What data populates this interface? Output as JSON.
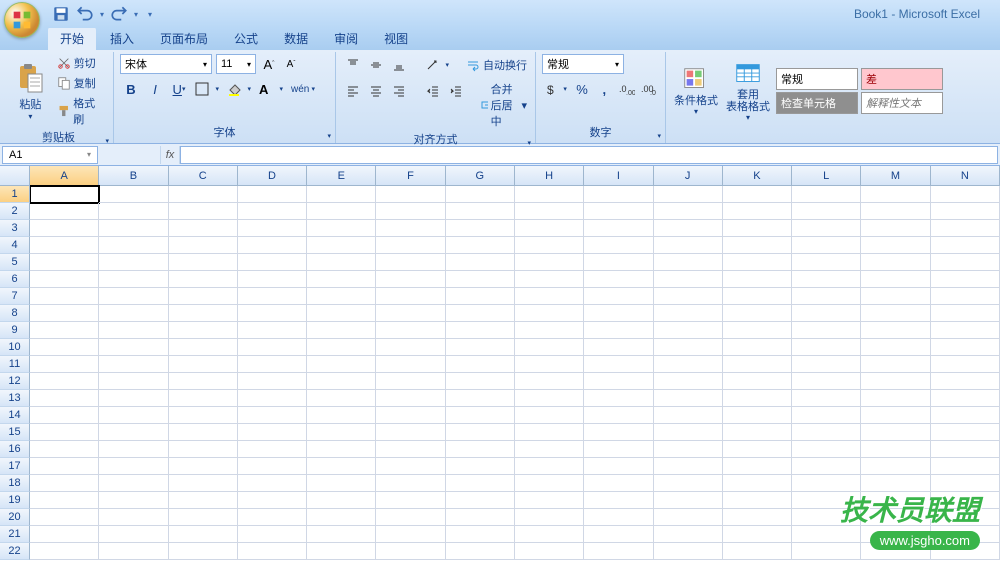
{
  "title": "Book1 - Microsoft Excel",
  "tabs": [
    "开始",
    "插入",
    "页面布局",
    "公式",
    "数据",
    "审阅",
    "视图"
  ],
  "active_tab": 0,
  "clipboard": {
    "paste": "粘贴",
    "cut": "剪切",
    "copy": "复制",
    "format_painter": "格式刷",
    "group": "剪贴板"
  },
  "font": {
    "name": "宋体",
    "size": "11",
    "group": "字体"
  },
  "alignment": {
    "wrap": "自动换行",
    "merge": "合并后居中",
    "group": "对齐方式"
  },
  "number": {
    "format": "常规",
    "group": "数字"
  },
  "styles": {
    "conditional": "条件格式",
    "table": "套用\n表格格式",
    "normal": "常规",
    "check": "检查单元格",
    "bad": "差",
    "note": "解释性文本"
  },
  "namebox": "A1",
  "columns": [
    "A",
    "B",
    "C",
    "D",
    "E",
    "F",
    "G",
    "H",
    "I",
    "J",
    "K",
    "L",
    "M",
    "N"
  ],
  "rows": [
    "1",
    "2",
    "3",
    "4",
    "5",
    "6",
    "7",
    "8",
    "9",
    "10",
    "11",
    "12",
    "13",
    "14",
    "15",
    "16",
    "17",
    "18",
    "19",
    "20",
    "21",
    "22"
  ],
  "active_cell": {
    "row": 0,
    "col": 0
  },
  "watermark": {
    "text": "技术员联盟",
    "url": "www.jsgho.com"
  }
}
